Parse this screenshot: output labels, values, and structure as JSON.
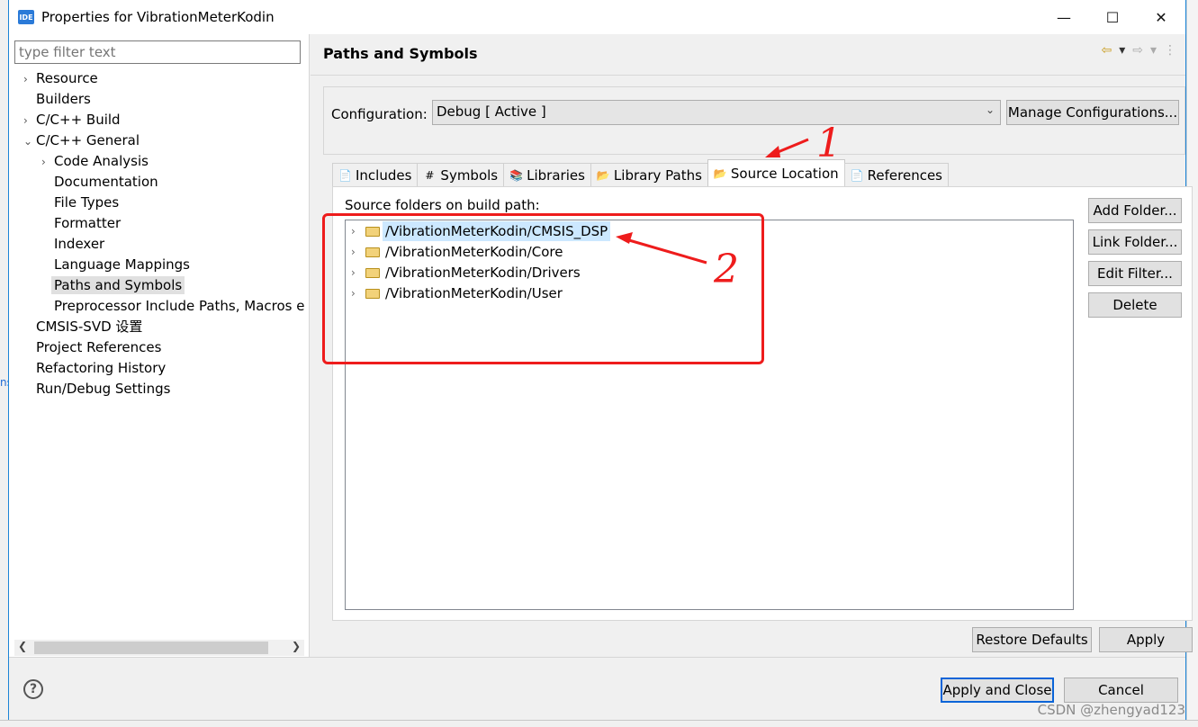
{
  "window": {
    "icon_label": "IDE",
    "title": "Properties for VibrationMeterKodin",
    "controls": {
      "minimize": "—",
      "maximize": "☐",
      "close": "✕"
    }
  },
  "filter": {
    "placeholder": "type filter text"
  },
  "tree": {
    "items": [
      {
        "label": "Resource",
        "expander": "›",
        "level": 0
      },
      {
        "label": "Builders",
        "expander": "",
        "level": 0
      },
      {
        "label": "C/C++ Build",
        "expander": "›",
        "level": 0
      },
      {
        "label": "C/C++ General",
        "expander": "⌄",
        "level": 0
      },
      {
        "label": "Code Analysis",
        "expander": "›",
        "level": 1
      },
      {
        "label": "Documentation",
        "expander": "",
        "level": 1
      },
      {
        "label": "File Types",
        "expander": "",
        "level": 1
      },
      {
        "label": "Formatter",
        "expander": "",
        "level": 1
      },
      {
        "label": "Indexer",
        "expander": "",
        "level": 1
      },
      {
        "label": "Language Mappings",
        "expander": "",
        "level": 1
      },
      {
        "label": "Paths and Symbols",
        "expander": "",
        "level": 1,
        "selected": true
      },
      {
        "label": "Preprocessor Include Paths, Macros e",
        "expander": "",
        "level": 1
      },
      {
        "label": "CMSIS-SVD 设置",
        "expander": "",
        "level": 0
      },
      {
        "label": "Project References",
        "expander": "",
        "level": 0
      },
      {
        "label": "Refactoring History",
        "expander": "",
        "level": 0
      },
      {
        "label": "Run/Debug Settings",
        "expander": "",
        "level": 0
      }
    ]
  },
  "page": {
    "title": "Paths and Symbols",
    "nav": {
      "back": "⇦",
      "back_menu": "▾",
      "forward": "⇨",
      "forward_menu": "▾",
      "more": "⋮"
    }
  },
  "configuration": {
    "label": "Configuration:",
    "selected": "Debug  [ Active ]",
    "manage_button": "Manage Configurations..."
  },
  "tabs": [
    {
      "label": "Includes",
      "icon": "include-icon",
      "glyph": "📄"
    },
    {
      "label": "Symbols",
      "icon": "hash-icon",
      "glyph": "#"
    },
    {
      "label": "Libraries",
      "icon": "library-icon",
      "glyph": "📚"
    },
    {
      "label": "Library Paths",
      "icon": "library-path-icon",
      "glyph": "📂"
    },
    {
      "label": "Source Location",
      "icon": "source-folder-icon",
      "glyph": "📂",
      "active": true
    },
    {
      "label": "References",
      "icon": "references-icon",
      "glyph": "📄"
    }
  ],
  "source_location": {
    "list_label": "Source folders on build path:",
    "folders": [
      {
        "path": "/VibrationMeterKodin/CMSIS_DSP",
        "selected": true
      },
      {
        "path": "/VibrationMeterKodin/Core"
      },
      {
        "path": "/VibrationMeterKodin/Drivers"
      },
      {
        "path": "/VibrationMeterKodin/User"
      }
    ],
    "buttons": {
      "add_folder": "Add Folder...",
      "link_folder": "Link Folder...",
      "edit_filter": "Edit Filter...",
      "delete": "Delete"
    }
  },
  "footer_buttons": {
    "restore_defaults": "Restore Defaults",
    "apply": "Apply",
    "apply_and_close": "Apply and Close",
    "cancel": "Cancel",
    "help": "?"
  },
  "annotations": {
    "one": "1",
    "two": "2"
  },
  "watermark": "CSDN @zhengyad123",
  "colors": {
    "accent": "#0a64d8",
    "annotation": "#ee1c1c",
    "selection": "#cce8ff"
  }
}
